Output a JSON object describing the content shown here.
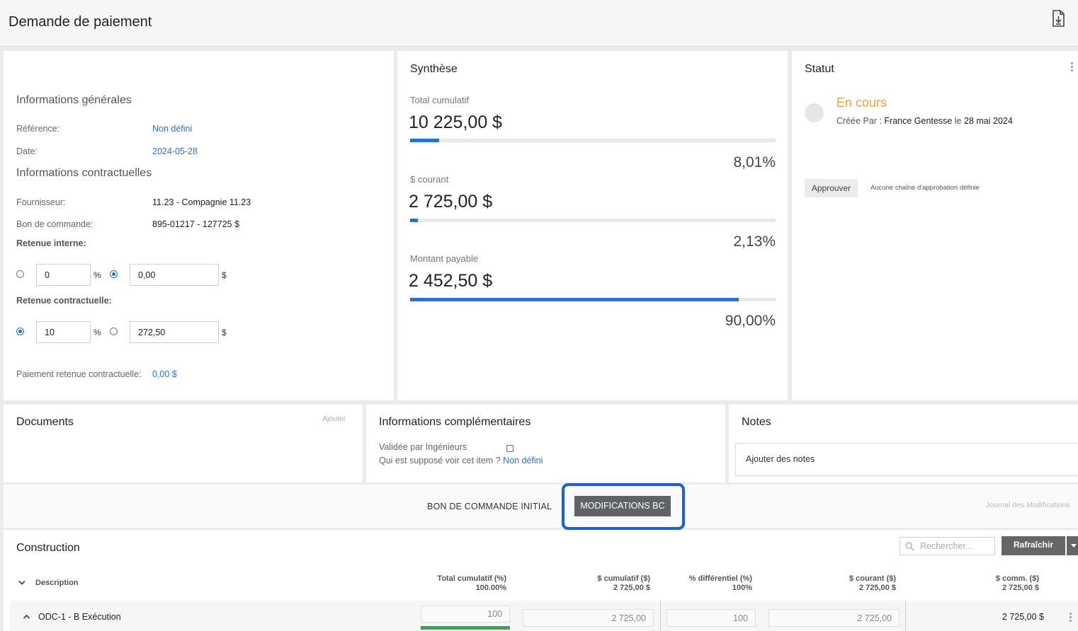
{
  "header": {
    "title": "Demande de paiement",
    "export_icon": "file-download-icon"
  },
  "general": {
    "section_title": "Informations générales",
    "reference_label": "Référence:",
    "reference_value": "Non défini",
    "date_label": "Date:",
    "date_value": "2024-05-28"
  },
  "contract": {
    "section_title": "Informations contractuelles",
    "supplier_label": "Fournisseur:",
    "supplier_value": "11.23 - Compagnie 11.23",
    "po_label": "Bon de commande:",
    "po_value": "895-01217 - 127725 $",
    "internal_label": "Retenue interne:",
    "internal_pct": "0",
    "internal_amount": "0,00",
    "contractual_label": "Retenue contractuelle:",
    "contractual_pct": "10",
    "contractual_amount": "272,50",
    "pct_unit": "%",
    "amount_unit": "$",
    "payment_label": "Paiement retenue contractuelle:",
    "payment_value": "0,00 $"
  },
  "synthese": {
    "title": "Synthèse",
    "items": [
      {
        "label": "Total cumulatif",
        "value": "10 225,00 $",
        "pct": "8,01%",
        "fill": 0.0801
      },
      {
        "label": "$ courant",
        "value": "2 725,00 $",
        "pct": "2,13%",
        "fill": 0.0213
      },
      {
        "label": "Montant payable",
        "value": "2 452,50 $",
        "pct": "90,00%",
        "fill": 0.9
      }
    ]
  },
  "statut": {
    "title": "Statut",
    "status": "En cours",
    "created_by_label": "Créée Par :",
    "created_by_name": "France Gentesse",
    "created_on_label": "le",
    "created_on_date": "28 mai 2024",
    "approve_button": "Approuver",
    "chain_note": "Aucune chaîne d'approbation définie",
    "status_color": "#f0a040"
  },
  "documents": {
    "title": "Documents",
    "add_link": "Ajouter"
  },
  "complementary": {
    "title": "Informations complémentaires",
    "validated_label": "Validée par Ingénieurs",
    "who_label": "Qui est supposé voir cet item ?",
    "who_value": "Non défini"
  },
  "notes": {
    "title": "Notes",
    "placeholder": "Ajouter des notes"
  },
  "tabs": {
    "initial": "BON DE COMMANDE INITIAL",
    "modifications": "MODIFICATIONS BC",
    "journal": "Journal des Modifications"
  },
  "construction": {
    "title": "Construction",
    "search_placeholder": "Rechercher...",
    "refresh_button": "Rafraîchir",
    "columns": [
      {
        "label": "Description",
        "total": ""
      },
      {
        "label": "Total cumulatif (%)",
        "total": "100.00%"
      },
      {
        "label": "$ cumulatif ($)",
        "total": "2 725,00 $"
      },
      {
        "label": "% différentiel (%)",
        "total": "100%"
      },
      {
        "label": "$ courant ($)",
        "total": "2 725,00 $"
      },
      {
        "label": "$ comm. ($)",
        "total": "2 725,00 $"
      }
    ],
    "row": {
      "description": "ODC-1 - B Exécution",
      "total_pct": "100",
      "total_pct_fill": 1.0,
      "cumul": "2 725,00",
      "diff_pct": "100",
      "courant": "2 725,00",
      "comm": "2 725,00 $"
    }
  },
  "colors": {
    "accent": "#1a73e8",
    "highlight": "#1a5ee8",
    "tab_active": "#5f6368",
    "progress_green": "#34a853"
  }
}
